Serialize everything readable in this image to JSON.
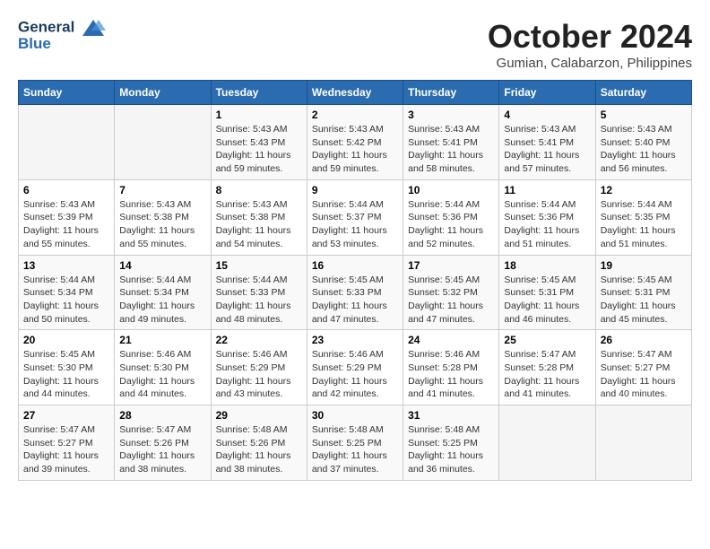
{
  "header": {
    "logo_line1": "General",
    "logo_line2": "Blue",
    "month_title": "October 2024",
    "subtitle": "Gumian, Calabarzon, Philippines"
  },
  "days_of_week": [
    "Sunday",
    "Monday",
    "Tuesday",
    "Wednesday",
    "Thursday",
    "Friday",
    "Saturday"
  ],
  "weeks": [
    [
      {
        "day": "",
        "info": ""
      },
      {
        "day": "",
        "info": ""
      },
      {
        "day": "1",
        "info": "Sunrise: 5:43 AM\nSunset: 5:43 PM\nDaylight: 11 hours and 59 minutes."
      },
      {
        "day": "2",
        "info": "Sunrise: 5:43 AM\nSunset: 5:42 PM\nDaylight: 11 hours and 59 minutes."
      },
      {
        "day": "3",
        "info": "Sunrise: 5:43 AM\nSunset: 5:41 PM\nDaylight: 11 hours and 58 minutes."
      },
      {
        "day": "4",
        "info": "Sunrise: 5:43 AM\nSunset: 5:41 PM\nDaylight: 11 hours and 57 minutes."
      },
      {
        "day": "5",
        "info": "Sunrise: 5:43 AM\nSunset: 5:40 PM\nDaylight: 11 hours and 56 minutes."
      }
    ],
    [
      {
        "day": "6",
        "info": "Sunrise: 5:43 AM\nSunset: 5:39 PM\nDaylight: 11 hours and 55 minutes."
      },
      {
        "day": "7",
        "info": "Sunrise: 5:43 AM\nSunset: 5:38 PM\nDaylight: 11 hours and 55 minutes."
      },
      {
        "day": "8",
        "info": "Sunrise: 5:43 AM\nSunset: 5:38 PM\nDaylight: 11 hours and 54 minutes."
      },
      {
        "day": "9",
        "info": "Sunrise: 5:44 AM\nSunset: 5:37 PM\nDaylight: 11 hours and 53 minutes."
      },
      {
        "day": "10",
        "info": "Sunrise: 5:44 AM\nSunset: 5:36 PM\nDaylight: 11 hours and 52 minutes."
      },
      {
        "day": "11",
        "info": "Sunrise: 5:44 AM\nSunset: 5:36 PM\nDaylight: 11 hours and 51 minutes."
      },
      {
        "day": "12",
        "info": "Sunrise: 5:44 AM\nSunset: 5:35 PM\nDaylight: 11 hours and 51 minutes."
      }
    ],
    [
      {
        "day": "13",
        "info": "Sunrise: 5:44 AM\nSunset: 5:34 PM\nDaylight: 11 hours and 50 minutes."
      },
      {
        "day": "14",
        "info": "Sunrise: 5:44 AM\nSunset: 5:34 PM\nDaylight: 11 hours and 49 minutes."
      },
      {
        "day": "15",
        "info": "Sunrise: 5:44 AM\nSunset: 5:33 PM\nDaylight: 11 hours and 48 minutes."
      },
      {
        "day": "16",
        "info": "Sunrise: 5:45 AM\nSunset: 5:33 PM\nDaylight: 11 hours and 47 minutes."
      },
      {
        "day": "17",
        "info": "Sunrise: 5:45 AM\nSunset: 5:32 PM\nDaylight: 11 hours and 47 minutes."
      },
      {
        "day": "18",
        "info": "Sunrise: 5:45 AM\nSunset: 5:31 PM\nDaylight: 11 hours and 46 minutes."
      },
      {
        "day": "19",
        "info": "Sunrise: 5:45 AM\nSunset: 5:31 PM\nDaylight: 11 hours and 45 minutes."
      }
    ],
    [
      {
        "day": "20",
        "info": "Sunrise: 5:45 AM\nSunset: 5:30 PM\nDaylight: 11 hours and 44 minutes."
      },
      {
        "day": "21",
        "info": "Sunrise: 5:46 AM\nSunset: 5:30 PM\nDaylight: 11 hours and 44 minutes."
      },
      {
        "day": "22",
        "info": "Sunrise: 5:46 AM\nSunset: 5:29 PM\nDaylight: 11 hours and 43 minutes."
      },
      {
        "day": "23",
        "info": "Sunrise: 5:46 AM\nSunset: 5:29 PM\nDaylight: 11 hours and 42 minutes."
      },
      {
        "day": "24",
        "info": "Sunrise: 5:46 AM\nSunset: 5:28 PM\nDaylight: 11 hours and 41 minutes."
      },
      {
        "day": "25",
        "info": "Sunrise: 5:47 AM\nSunset: 5:28 PM\nDaylight: 11 hours and 41 minutes."
      },
      {
        "day": "26",
        "info": "Sunrise: 5:47 AM\nSunset: 5:27 PM\nDaylight: 11 hours and 40 minutes."
      }
    ],
    [
      {
        "day": "27",
        "info": "Sunrise: 5:47 AM\nSunset: 5:27 PM\nDaylight: 11 hours and 39 minutes."
      },
      {
        "day": "28",
        "info": "Sunrise: 5:47 AM\nSunset: 5:26 PM\nDaylight: 11 hours and 38 minutes."
      },
      {
        "day": "29",
        "info": "Sunrise: 5:48 AM\nSunset: 5:26 PM\nDaylight: 11 hours and 38 minutes."
      },
      {
        "day": "30",
        "info": "Sunrise: 5:48 AM\nSunset: 5:25 PM\nDaylight: 11 hours and 37 minutes."
      },
      {
        "day": "31",
        "info": "Sunrise: 5:48 AM\nSunset: 5:25 PM\nDaylight: 11 hours and 36 minutes."
      },
      {
        "day": "",
        "info": ""
      },
      {
        "day": "",
        "info": ""
      }
    ]
  ]
}
